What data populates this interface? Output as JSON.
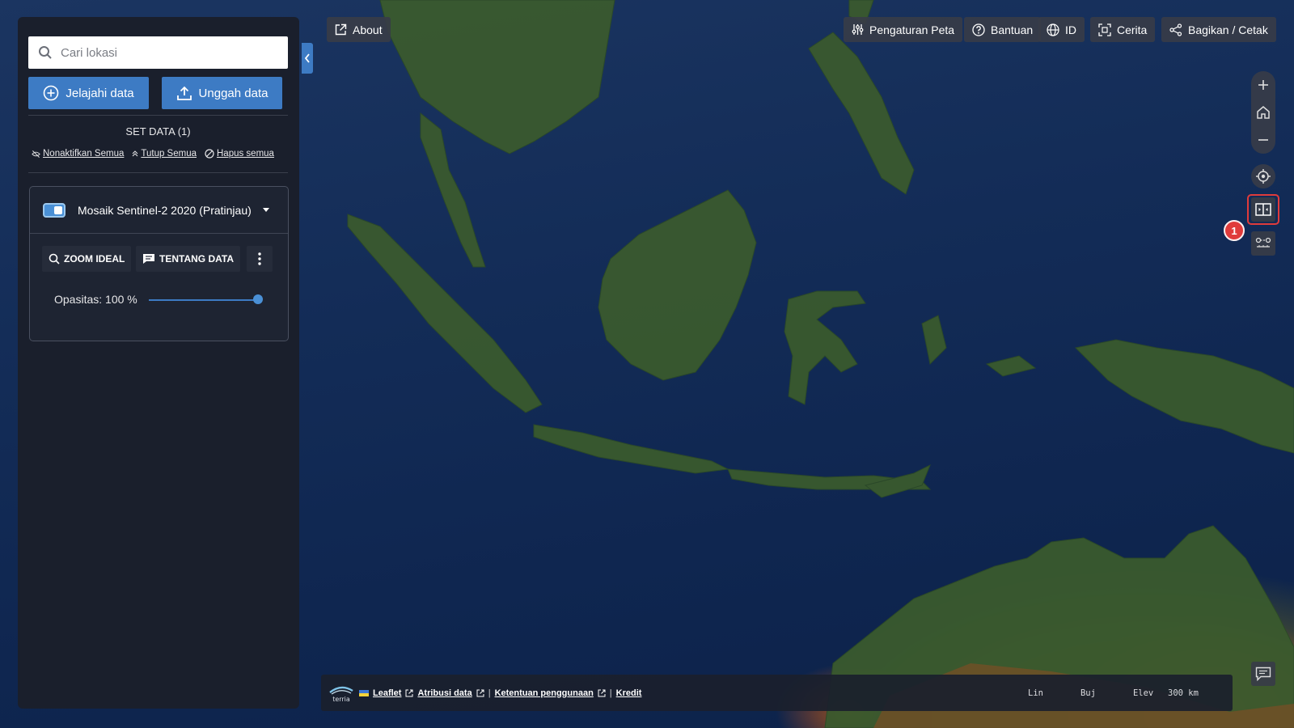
{
  "search": {
    "placeholder": "Cari lokasi"
  },
  "workbench": {
    "explore_label": "Jelajahi data",
    "upload_label": "Unggah data",
    "dataset_count_label": "SET DATA (1)",
    "actions": {
      "disable_all": "Nonaktifkan Semua",
      "collapse_all": "Tutup Semua",
      "remove_all": "Hapus semua"
    },
    "item": {
      "title": "Mosaik Sentinel-2 2020 (Pratinjau)",
      "enabled": true,
      "zoom_label": "ZOOM IDEAL",
      "about_label": "TENTANG DATA",
      "opacity_label": "Opasitas: 100 %",
      "opacity_value": 1.0
    }
  },
  "nav": {
    "about": "About",
    "map_settings": "Pengaturan Peta",
    "help": "Bantuan",
    "language": "ID",
    "story": "Cerita",
    "share": "Bagikan / Cetak"
  },
  "controls": {
    "badge": "1",
    "icons": [
      "plus-icon",
      "home-icon",
      "minus-icon",
      "locate-icon",
      "compare-split-icon",
      "measure-icon",
      "feedback-icon"
    ]
  },
  "footer": {
    "leaflet": "Leaflet",
    "attribution": "Atribusi data",
    "terms": "Ketentuan penggunaan",
    "credits": "Kredit",
    "separator": "|",
    "lat_label": "Lin",
    "lon_label": "Buj",
    "elev_label": "Elev",
    "scale": "300 km",
    "logo_text": "terria"
  },
  "colors": {
    "accent": "#3d7bc4",
    "panel": "#1a1f2c",
    "highlight": "#e03b3b"
  }
}
